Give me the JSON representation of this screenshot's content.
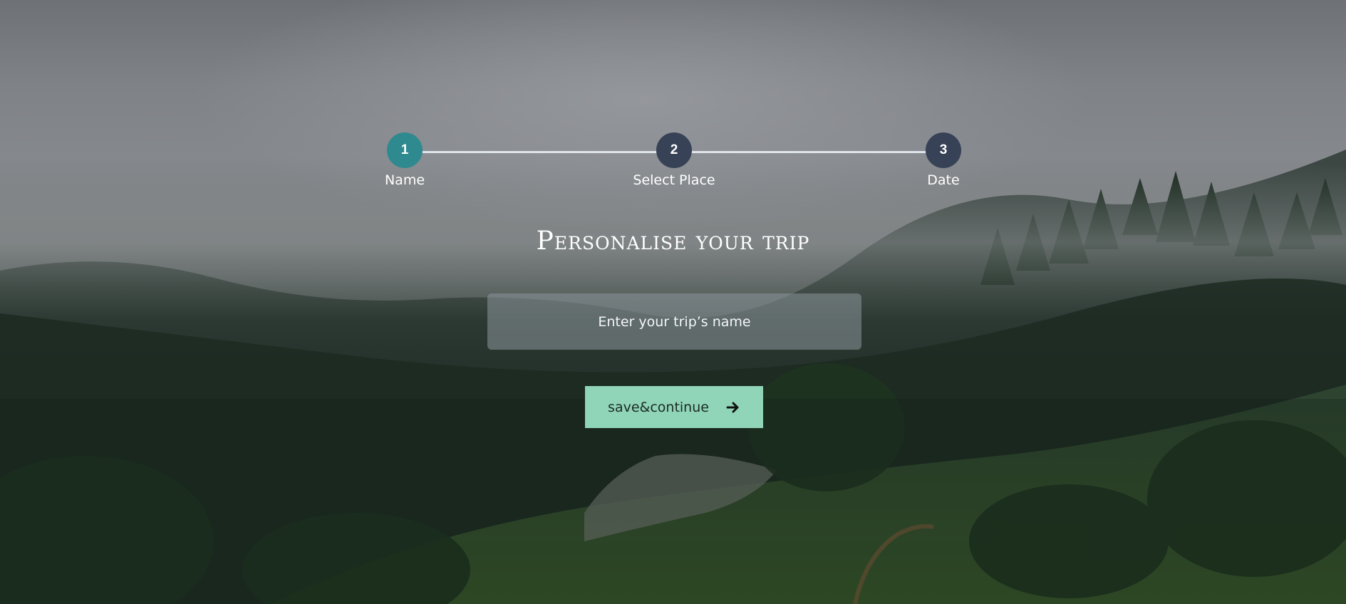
{
  "stepper": {
    "steps": [
      {
        "number": "1",
        "label": "Name",
        "state": "active"
      },
      {
        "number": "2",
        "label": "Select Place",
        "state": "inactive"
      },
      {
        "number": "3",
        "label": "Date",
        "state": "inactive"
      }
    ],
    "colors": {
      "active": "#2e8a8f",
      "inactive": "#374257",
      "track": "#dfe4ea"
    }
  },
  "main": {
    "title": "Personalise your trip",
    "trip_name_input": {
      "value": "",
      "placeholder": "Enter your trip’s name"
    },
    "save_button": {
      "label": "save&continue",
      "icon": "arrow-right-icon",
      "color": "#91d5b9"
    }
  }
}
